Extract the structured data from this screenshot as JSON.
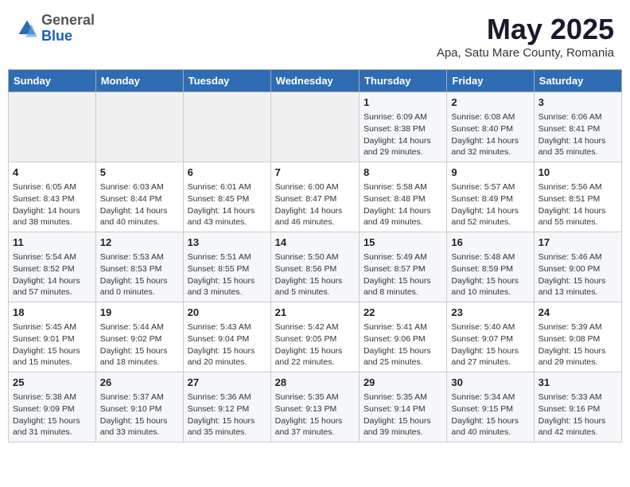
{
  "header": {
    "logo_general": "General",
    "logo_blue": "Blue",
    "month": "May 2025",
    "location": "Apa, Satu Mare County, Romania"
  },
  "days_of_week": [
    "Sunday",
    "Monday",
    "Tuesday",
    "Wednesday",
    "Thursday",
    "Friday",
    "Saturday"
  ],
  "weeks": [
    [
      {
        "day": "",
        "info": ""
      },
      {
        "day": "",
        "info": ""
      },
      {
        "day": "",
        "info": ""
      },
      {
        "day": "",
        "info": ""
      },
      {
        "day": "1",
        "info": "Sunrise: 6:09 AM\nSunset: 8:38 PM\nDaylight: 14 hours and 29 minutes."
      },
      {
        "day": "2",
        "info": "Sunrise: 6:08 AM\nSunset: 8:40 PM\nDaylight: 14 hours and 32 minutes."
      },
      {
        "day": "3",
        "info": "Sunrise: 6:06 AM\nSunset: 8:41 PM\nDaylight: 14 hours and 35 minutes."
      }
    ],
    [
      {
        "day": "4",
        "info": "Sunrise: 6:05 AM\nSunset: 8:43 PM\nDaylight: 14 hours and 38 minutes."
      },
      {
        "day": "5",
        "info": "Sunrise: 6:03 AM\nSunset: 8:44 PM\nDaylight: 14 hours and 40 minutes."
      },
      {
        "day": "6",
        "info": "Sunrise: 6:01 AM\nSunset: 8:45 PM\nDaylight: 14 hours and 43 minutes."
      },
      {
        "day": "7",
        "info": "Sunrise: 6:00 AM\nSunset: 8:47 PM\nDaylight: 14 hours and 46 minutes."
      },
      {
        "day": "8",
        "info": "Sunrise: 5:58 AM\nSunset: 8:48 PM\nDaylight: 14 hours and 49 minutes."
      },
      {
        "day": "9",
        "info": "Sunrise: 5:57 AM\nSunset: 8:49 PM\nDaylight: 14 hours and 52 minutes."
      },
      {
        "day": "10",
        "info": "Sunrise: 5:56 AM\nSunset: 8:51 PM\nDaylight: 14 hours and 55 minutes."
      }
    ],
    [
      {
        "day": "11",
        "info": "Sunrise: 5:54 AM\nSunset: 8:52 PM\nDaylight: 14 hours and 57 minutes."
      },
      {
        "day": "12",
        "info": "Sunrise: 5:53 AM\nSunset: 8:53 PM\nDaylight: 15 hours and 0 minutes."
      },
      {
        "day": "13",
        "info": "Sunrise: 5:51 AM\nSunset: 8:55 PM\nDaylight: 15 hours and 3 minutes."
      },
      {
        "day": "14",
        "info": "Sunrise: 5:50 AM\nSunset: 8:56 PM\nDaylight: 15 hours and 5 minutes."
      },
      {
        "day": "15",
        "info": "Sunrise: 5:49 AM\nSunset: 8:57 PM\nDaylight: 15 hours and 8 minutes."
      },
      {
        "day": "16",
        "info": "Sunrise: 5:48 AM\nSunset: 8:59 PM\nDaylight: 15 hours and 10 minutes."
      },
      {
        "day": "17",
        "info": "Sunrise: 5:46 AM\nSunset: 9:00 PM\nDaylight: 15 hours and 13 minutes."
      }
    ],
    [
      {
        "day": "18",
        "info": "Sunrise: 5:45 AM\nSunset: 9:01 PM\nDaylight: 15 hours and 15 minutes."
      },
      {
        "day": "19",
        "info": "Sunrise: 5:44 AM\nSunset: 9:02 PM\nDaylight: 15 hours and 18 minutes."
      },
      {
        "day": "20",
        "info": "Sunrise: 5:43 AM\nSunset: 9:04 PM\nDaylight: 15 hours and 20 minutes."
      },
      {
        "day": "21",
        "info": "Sunrise: 5:42 AM\nSunset: 9:05 PM\nDaylight: 15 hours and 22 minutes."
      },
      {
        "day": "22",
        "info": "Sunrise: 5:41 AM\nSunset: 9:06 PM\nDaylight: 15 hours and 25 minutes."
      },
      {
        "day": "23",
        "info": "Sunrise: 5:40 AM\nSunset: 9:07 PM\nDaylight: 15 hours and 27 minutes."
      },
      {
        "day": "24",
        "info": "Sunrise: 5:39 AM\nSunset: 9:08 PM\nDaylight: 15 hours and 29 minutes."
      }
    ],
    [
      {
        "day": "25",
        "info": "Sunrise: 5:38 AM\nSunset: 9:09 PM\nDaylight: 15 hours and 31 minutes."
      },
      {
        "day": "26",
        "info": "Sunrise: 5:37 AM\nSunset: 9:10 PM\nDaylight: 15 hours and 33 minutes."
      },
      {
        "day": "27",
        "info": "Sunrise: 5:36 AM\nSunset: 9:12 PM\nDaylight: 15 hours and 35 minutes."
      },
      {
        "day": "28",
        "info": "Sunrise: 5:35 AM\nSunset: 9:13 PM\nDaylight: 15 hours and 37 minutes."
      },
      {
        "day": "29",
        "info": "Sunrise: 5:35 AM\nSunset: 9:14 PM\nDaylight: 15 hours and 39 minutes."
      },
      {
        "day": "30",
        "info": "Sunrise: 5:34 AM\nSunset: 9:15 PM\nDaylight: 15 hours and 40 minutes."
      },
      {
        "day": "31",
        "info": "Sunrise: 5:33 AM\nSunset: 9:16 PM\nDaylight: 15 hours and 42 minutes."
      }
    ]
  ]
}
